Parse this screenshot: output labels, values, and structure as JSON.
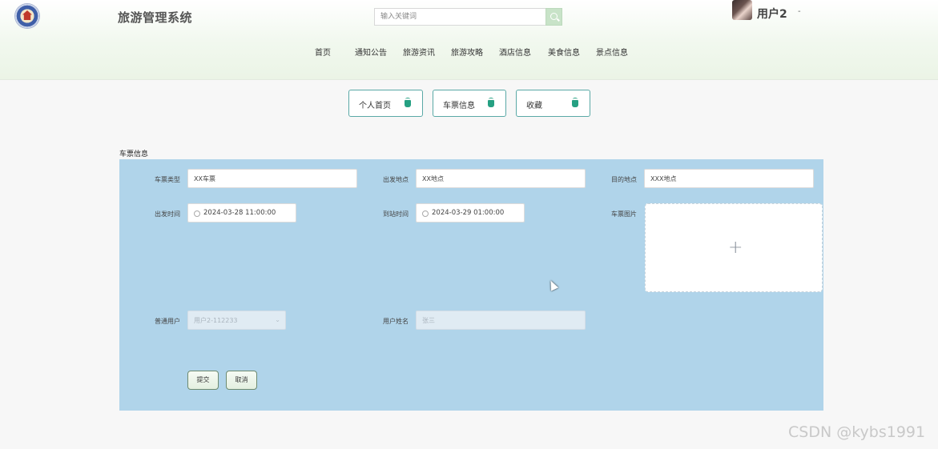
{
  "header": {
    "title": "旅游管理系统",
    "search": {
      "placeholder": "输入关键词",
      "button_icon": "search-icon"
    },
    "user": {
      "name": "用户2",
      "caret": "-"
    },
    "nav": [
      "首页",
      "通知公告",
      "旅游资讯",
      "旅游攻略",
      "酒店信息",
      "美食信息",
      "景点信息"
    ]
  },
  "tabs": [
    {
      "label": "个人首页",
      "icon": "home-icon"
    },
    {
      "label": "车票信息",
      "icon": "home-icon"
    },
    {
      "label": "收藏",
      "icon": "home-icon"
    }
  ],
  "form": {
    "section_title": "车票信息",
    "ticket_type": {
      "label": "车票类型",
      "value": "XX车票"
    },
    "departure_place": {
      "label": "出发地点",
      "value": "XX地点"
    },
    "destination": {
      "label": "目的地点",
      "value": "XXX地点"
    },
    "departure_time": {
      "label": "出发时间",
      "value": "2024-03-28 11:00:00"
    },
    "arrival_time": {
      "label": "到站时间",
      "value": "2024-03-29 01:00:00"
    },
    "ticket_image": {
      "label": "车票图片",
      "upload_symbol": "+"
    },
    "normal_user": {
      "label": "普通用户",
      "value": "用户2-112233"
    },
    "user_name": {
      "label": "用户姓名",
      "value": "张三"
    },
    "submit_label": "提交",
    "cancel_label": "取消"
  },
  "watermark": "CSDN @kybs1991",
  "colors": {
    "panel": "#b0d4ea",
    "tab_border": "#5aa9a6",
    "accent_icon": "#25a082"
  }
}
